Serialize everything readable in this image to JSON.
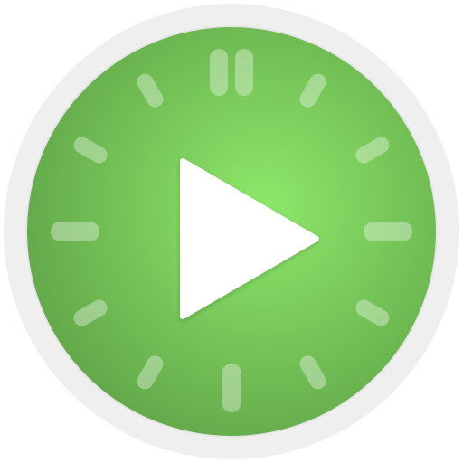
{
  "app_icon": {
    "icon": "timer-play-icon",
    "ring_color": "#efefef",
    "face_color_center": "#8ee86a",
    "face_color_edge": "#62a74a",
    "tick_color": "#ffffff",
    "tick_opacity": 0.35,
    "play_color": "#ffffff"
  }
}
